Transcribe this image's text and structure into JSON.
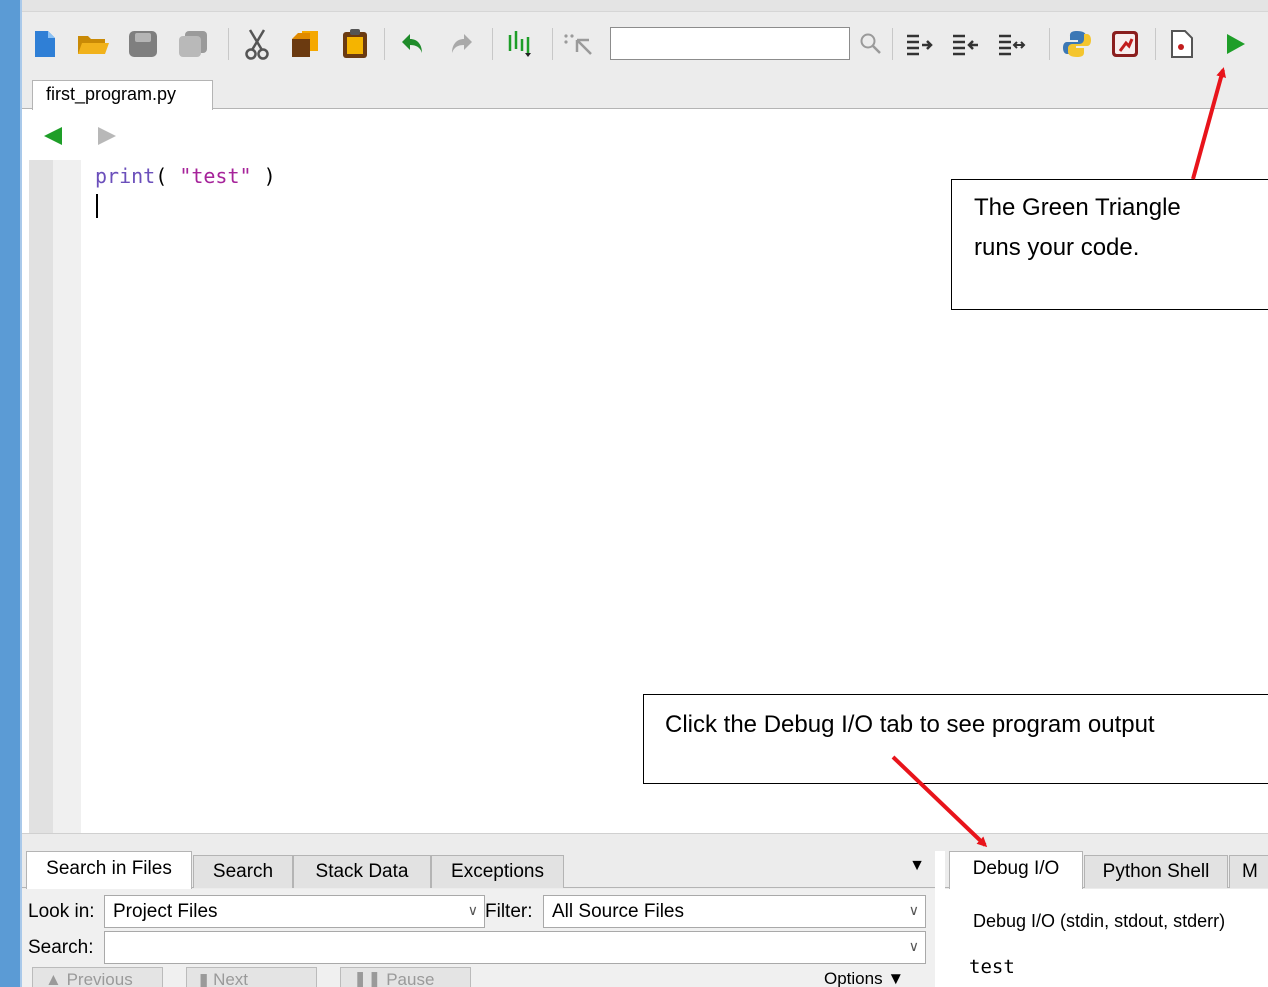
{
  "window": {
    "accent": "#5b9bd5"
  },
  "toolbar": {
    "buttons": [
      "new-file-icon",
      "open-folder-icon",
      "save-icon",
      "save-all-icon",
      "cut-icon",
      "copy-icon",
      "paste-icon",
      "undo-icon",
      "redo-icon",
      "indent-guides-icon",
      "select-icon",
      "search-go-icon",
      "indent-right-icon",
      "indent-left-icon",
      "indent-toggle-icon",
      "python-icon",
      "debug-config-icon",
      "new-breakpoint-icon",
      "run-icon"
    ],
    "search_value": "",
    "run_color": "#1e9e28"
  },
  "editor": {
    "tab_label": "first_program.py",
    "code": {
      "func": "print",
      "open": "( ",
      "arg": "\"test\"",
      "close": " )"
    }
  },
  "bottom_left": {
    "tabs": [
      "Search in Files",
      "Search",
      "Stack Data",
      "Exceptions"
    ],
    "active_tab": "Search in Files",
    "look_in_label": "Look in:",
    "look_in_value": "Project Files",
    "filter_label": "Filter:",
    "filter_value": "All Source Files",
    "search_label": "Search:",
    "search_value": "",
    "buttons": [
      "Previous",
      "Next",
      "Pause",
      "Options"
    ]
  },
  "bottom_right": {
    "tabs": [
      "Debug I/O",
      "Python Shell",
      "M"
    ],
    "active_tab": "Debug I/O",
    "header": "Debug I/O (stdin, stdout, stderr)",
    "output": "test"
  },
  "annotations": {
    "run_note_line1": "The Green Triangle",
    "run_note_line2": "runs your code.",
    "debug_note": "Click the Debug I/O tab to see program output",
    "arrow_color": "#e8141b"
  }
}
